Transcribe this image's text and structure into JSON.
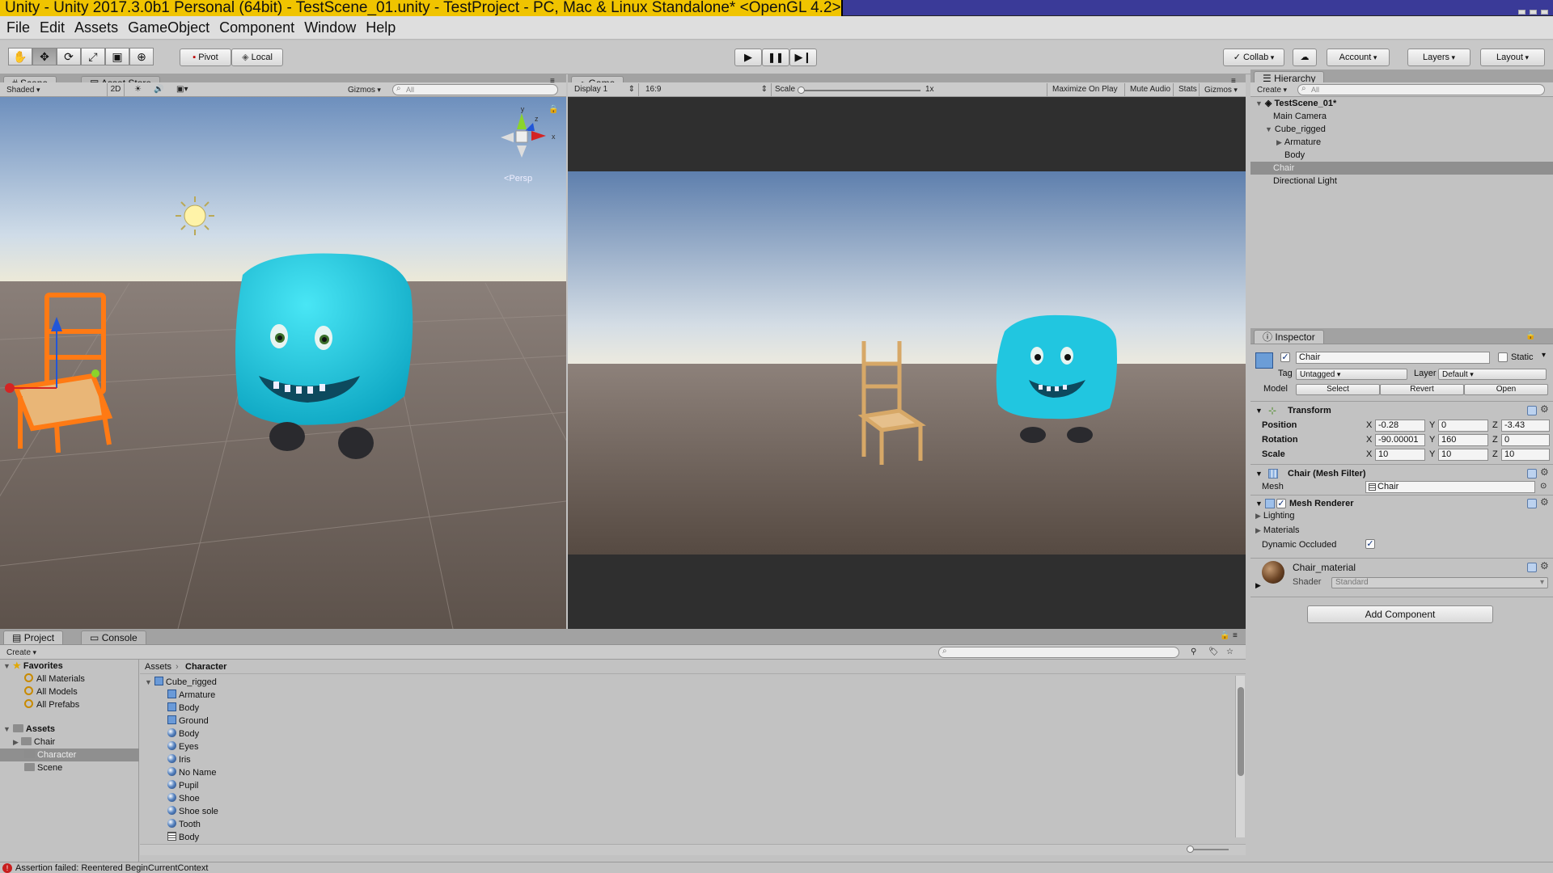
{
  "window": {
    "title": "Unity - Unity 2017.3.0b1 Personal (64bit) - TestScene_01.unity - TestProject - PC, Mac & Linux Standalone* <OpenGL 4.2>"
  },
  "menu": [
    "File",
    "Edit",
    "Assets",
    "GameObject",
    "Component",
    "Window",
    "Help"
  ],
  "toolbar": {
    "pivot": "Pivot",
    "local": "Local",
    "collab": "Collab",
    "account": "Account",
    "layers": "Layers",
    "layout": "Layout"
  },
  "scene": {
    "tab_scene": "Scene",
    "tab_asset_store": "Asset Store",
    "shading": "Shaded",
    "mode_2d": "2D",
    "gizmos": "Gizmos",
    "search_placeholder": "All",
    "persp": "<Persp",
    "axis_x": "x",
    "axis_y": "y",
    "axis_z": "z"
  },
  "game": {
    "tab": "Game",
    "display": "Display 1",
    "aspect": "16:9",
    "scale_label": "Scale",
    "scale_value": "1x",
    "maximize": "Maximize On Play",
    "mute": "Mute Audio",
    "stats": "Stats",
    "gizmos": "Gizmos"
  },
  "hierarchy": {
    "tab": "Hierarchy",
    "create": "Create",
    "search_placeholder": "All",
    "scene": "TestScene_01*",
    "items": [
      "Main Camera",
      "Cube_rigged",
      "Armature",
      "Body",
      "Chair",
      "Directional Light"
    ]
  },
  "inspector": {
    "tab": "Inspector",
    "name": "Chair",
    "static": "Static",
    "tag_label": "Tag",
    "tag": "Untagged",
    "layer_label": "Layer",
    "layer": "Default",
    "model_label": "Model",
    "select": "Select",
    "revert": "Revert",
    "open": "Open",
    "transform": {
      "title": "Transform",
      "rows": [
        {
          "label": "Position",
          "x": "-0.28",
          "y": "0",
          "z": "-3.43"
        },
        {
          "label": "Rotation",
          "x": "-90.00001",
          "y": "160",
          "z": "0"
        },
        {
          "label": "Scale",
          "x": "10",
          "y": "10",
          "z": "10"
        }
      ],
      "x": "X",
      "y": "Y",
      "z": "Z"
    },
    "mesh_filter": {
      "title": "Chair (Mesh Filter)",
      "mesh_label": "Mesh",
      "mesh": "Chair"
    },
    "mesh_renderer": {
      "title": "Mesh Renderer",
      "lighting": "Lighting",
      "materials": "Materials",
      "dynamic_occluded": "Dynamic Occluded"
    },
    "material": {
      "name": "Chair_material",
      "shader_label": "Shader",
      "shader": "Standard"
    },
    "add_component": "Add Component"
  },
  "project": {
    "tab_project": "Project",
    "tab_console": "Console",
    "create": "Create",
    "favorites": "Favorites",
    "fav_items": [
      "All Materials",
      "All Models",
      "All Prefabs"
    ],
    "assets": "Assets",
    "asset_folders": [
      "Chair",
      "Character",
      "Scene"
    ],
    "breadcrumb": [
      "Assets",
      "Character"
    ],
    "files": [
      {
        "name": "Cube_rigged",
        "icon": "model"
      },
      {
        "name": "Armature",
        "icon": "mesh"
      },
      {
        "name": "Body",
        "icon": "mesh"
      },
      {
        "name": "Ground",
        "icon": "mesh"
      },
      {
        "name": "Body",
        "icon": "material"
      },
      {
        "name": "Eyes",
        "icon": "material"
      },
      {
        "name": "Iris",
        "icon": "material"
      },
      {
        "name": "No Name",
        "icon": "material"
      },
      {
        "name": "Pupil",
        "icon": "material"
      },
      {
        "name": "Shoe",
        "icon": "material"
      },
      {
        "name": "Shoe sole",
        "icon": "material"
      },
      {
        "name": "Tooth",
        "icon": "material"
      },
      {
        "name": "Body",
        "icon": "grid"
      }
    ]
  },
  "status": {
    "message": "Assertion failed: Reentered BeginCurrentContext"
  }
}
